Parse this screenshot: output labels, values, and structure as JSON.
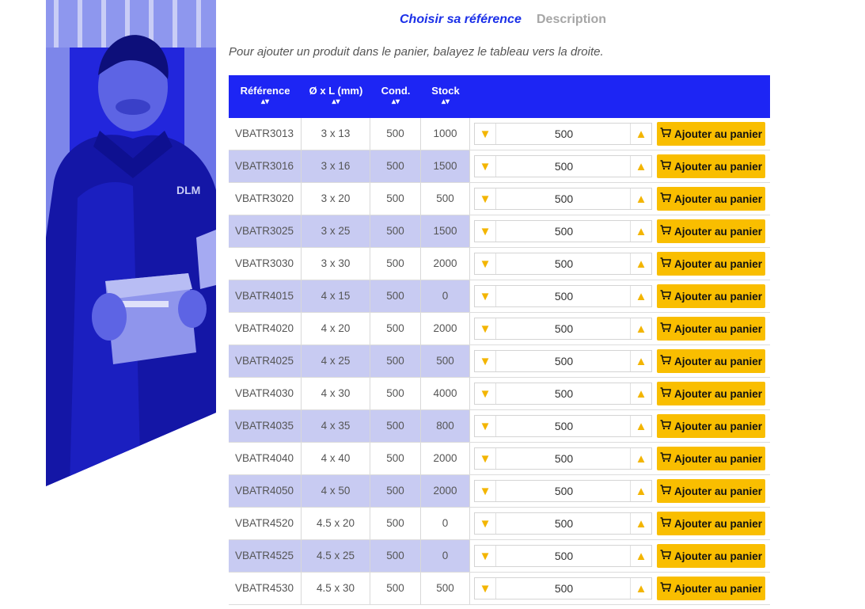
{
  "tabs": [
    {
      "label": "Choisir sa référence",
      "active": true
    },
    {
      "label": "Description",
      "active": false
    }
  ],
  "hint": "Pour ajouter un produit dans le panier, balayez le tableau vers la droite.",
  "table": {
    "headers": {
      "reference": "Référence",
      "dimensions": "Ø x L (mm)",
      "cond": "Cond.",
      "stock": "Stock",
      "sort_icon": "▴▾"
    },
    "add_label": "Ajouter au panier",
    "decrement_symbol": "▼",
    "increment_symbol": "▲",
    "rows": [
      {
        "ref": "VBATR3013",
        "dim": "3 x 13",
        "cond": "500",
        "stock": "1000",
        "qty": "500"
      },
      {
        "ref": "VBATR3016",
        "dim": "3 x 16",
        "cond": "500",
        "stock": "1500",
        "qty": "500"
      },
      {
        "ref": "VBATR3020",
        "dim": "3 x 20",
        "cond": "500",
        "stock": "500",
        "qty": "500"
      },
      {
        "ref": "VBATR3025",
        "dim": "3 x 25",
        "cond": "500",
        "stock": "1500",
        "qty": "500"
      },
      {
        "ref": "VBATR3030",
        "dim": "3 x 30",
        "cond": "500",
        "stock": "2000",
        "qty": "500"
      },
      {
        "ref": "VBATR4015",
        "dim": "4 x 15",
        "cond": "500",
        "stock": "0",
        "qty": "500"
      },
      {
        "ref": "VBATR4020",
        "dim": "4 x 20",
        "cond": "500",
        "stock": "2000",
        "qty": "500"
      },
      {
        "ref": "VBATR4025",
        "dim": "4 x 25",
        "cond": "500",
        "stock": "500",
        "qty": "500"
      },
      {
        "ref": "VBATR4030",
        "dim": "4 x 30",
        "cond": "500",
        "stock": "4000",
        "qty": "500"
      },
      {
        "ref": "VBATR4035",
        "dim": "4 x 35",
        "cond": "500",
        "stock": "800",
        "qty": "500"
      },
      {
        "ref": "VBATR4040",
        "dim": "4 x 40",
        "cond": "500",
        "stock": "2000",
        "qty": "500"
      },
      {
        "ref": "VBATR4050",
        "dim": "4 x 50",
        "cond": "500",
        "stock": "2000",
        "qty": "500"
      },
      {
        "ref": "VBATR4520",
        "dim": "4.5 x 20",
        "cond": "500",
        "stock": "0",
        "qty": "500"
      },
      {
        "ref": "VBATR4525",
        "dim": "4.5 x 25",
        "cond": "500",
        "stock": "0",
        "qty": "500"
      },
      {
        "ref": "VBATR4530",
        "dim": "4.5 x 30",
        "cond": "500",
        "stock": "500",
        "qty": "500"
      }
    ]
  },
  "colors": {
    "header_blue": "#1d25f4",
    "row_alt": "#c8cbf2",
    "button_yellow": "#f9be00",
    "stepper_arrow": "#f3b500",
    "active_tab": "#1a2fe8"
  }
}
